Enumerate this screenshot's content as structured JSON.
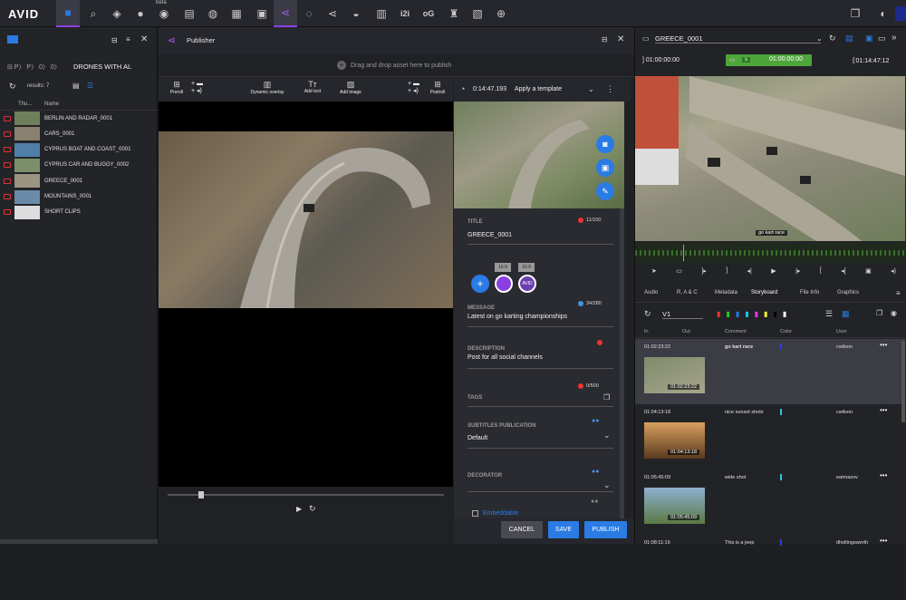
{
  "topbar": {
    "logo": "AVID",
    "beta": "beta",
    "i2i": "i2i",
    "og": "oG"
  },
  "left": {
    "breadcrumb": "DRONES WITH AL",
    "results": "results: 7",
    "col_thumb": "Thu...",
    "col_name": "Name",
    "items": [
      {
        "name": "BERLIN AND RADAR_0001"
      },
      {
        "name": "CARS_0001"
      },
      {
        "name": "CYPRUS BOAT AND COAST_0001"
      },
      {
        "name": "CYPRUS CAR AND BUGGY_0002"
      },
      {
        "name": "GREECE_0001"
      },
      {
        "name": "MOUNTAINS_0001"
      },
      {
        "name": "SHORT CLIPS"
      }
    ]
  },
  "publisher": {
    "title": "Publisher",
    "drop_hint": "Drag and drop asset here to publish",
    "tools": {
      "preroll": "Preroll",
      "dynamic_overlay": "Dynamic overlay",
      "add_text": "Add text",
      "add_image": "Add image",
      "postroll": "Postroll"
    },
    "duration": "0:14:47.193",
    "template": "Apply a template",
    "title_label": "TITLE",
    "title_count": "11/100",
    "title_value": "GREECE_0001",
    "ratio1": "16:9",
    "ratio2": "16:9",
    "message_label": "MESSAGE",
    "message_count": "34/280",
    "message_value": "Latest on go karting championships",
    "description_label": "DESCRIPTION",
    "description_value": "Post for all social channels",
    "tags_label": "TAGS",
    "tags_count": "0/500",
    "subtitles_label": "SUBTITLES PUBLICATION",
    "subtitles_value": "Default",
    "decorator_label": "DECORATOR",
    "embeddable": "Embeddable",
    "cancel": "CANCEL",
    "save": "SAVE",
    "publish": "PUBLISH"
  },
  "right": {
    "clip_name": "GREECE_0001",
    "tc_in": "01:00:00:00",
    "tc_mid_mode": "s",
    "tc_mid": "01:00:00:00",
    "tc_out": "01:14:47:12",
    "overlay_text": "go kart race",
    "tabs": [
      "Audio",
      "R, A & C",
      "Metadata",
      "Storyboard",
      "File Info",
      "Graphics"
    ],
    "track": "V1",
    "columns": {
      "in": "In",
      "out": "Out",
      "comment": "Comment",
      "color": "Color",
      "user": "User"
    },
    "rows": [
      {
        "in": "01:02:23:22",
        "comment": "go kart race",
        "user": "cwilson",
        "thumb_tc": "01:02:23:22",
        "color": "#2a3ee0"
      },
      {
        "in": "01:04:13:18",
        "comment": "nice sunset shots",
        "user": "cwilson",
        "thumb_tc": "01:04:13:18",
        "color": "#2ac6e0"
      },
      {
        "in": "01:05:45:09",
        "comment": "wide shot",
        "user": "eatmazov",
        "thumb_tc": "01:05:45:09",
        "color": "#2ac6e0"
      },
      {
        "in": "01:08:11:19",
        "comment": "This is a jeep",
        "user": "dhollingsworth",
        "thumb_tc": "",
        "color": "#2a3ee0"
      }
    ]
  }
}
